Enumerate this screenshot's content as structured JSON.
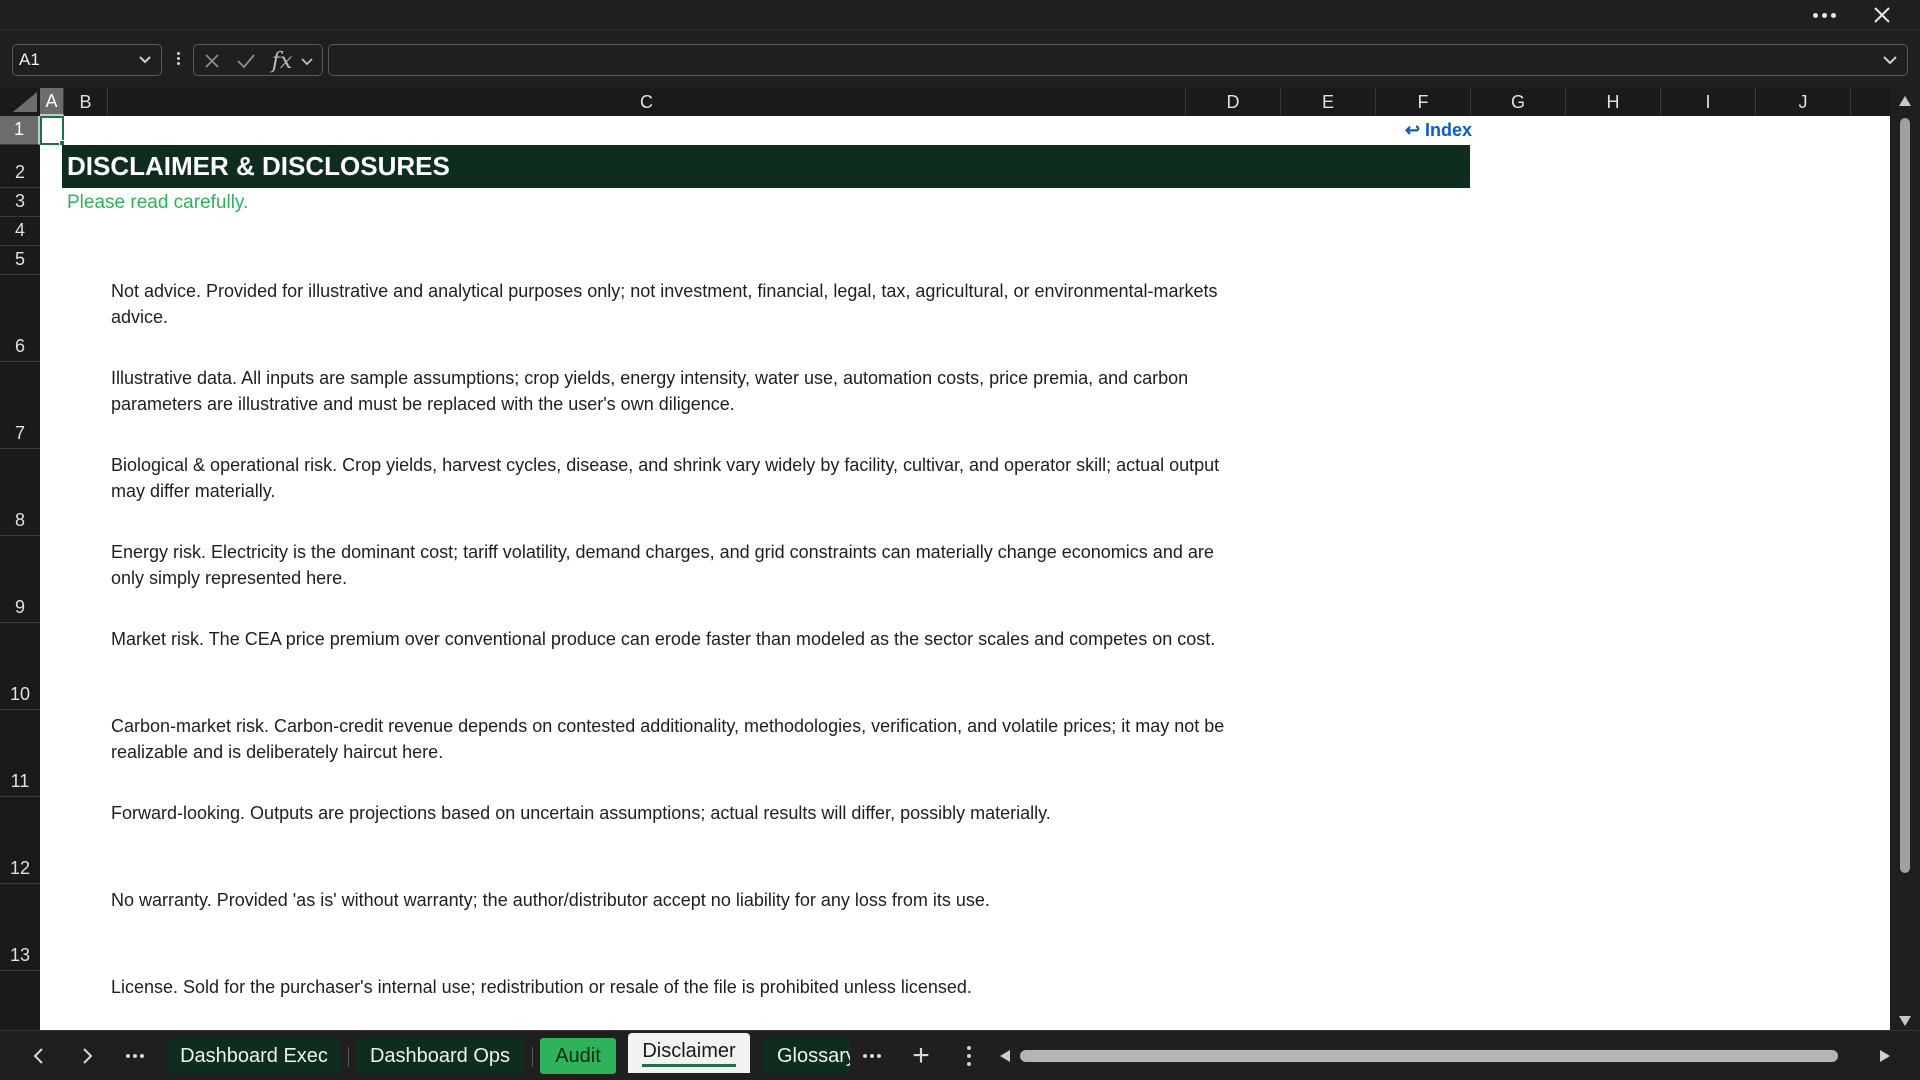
{
  "formula_bar": {
    "name_box": "A1",
    "formula": ""
  },
  "columns": [
    "A",
    "B",
    "C",
    "D",
    "E",
    "F",
    "G",
    "H",
    "I",
    "J"
  ],
  "rows": [
    "1",
    "2",
    "3",
    "4",
    "5",
    "6",
    "7",
    "8",
    "9",
    "10",
    "11",
    "12",
    "13"
  ],
  "sheet": {
    "index_link": "↩ Index",
    "banner": "DISCLAIMER & DISCLOSURES",
    "subtitle": "Please read carefully.",
    "paragraphs": [
      "Not advice. Provided for illustrative and analytical purposes only; not investment, financial, legal, tax, agricultural, or environmental-markets advice.",
      "Illustrative data. All inputs are sample assumptions; crop yields, energy intensity, water use, automation costs, price premia, and carbon parameters are illustrative and must be replaced with the user's own diligence.",
      "Biological & operational risk. Crop yields, harvest cycles, disease, and shrink vary widely by facility, cultivar, and operator skill; actual output may differ materially.",
      "Energy risk. Electricity is the dominant cost; tariff volatility, demand charges, and grid constraints can materially change economics and are only simply represented here.",
      "Market risk. The CEA price premium over conventional produce can erode faster than modeled as the sector scales and competes on cost.",
      "Carbon-market risk. Carbon-credit revenue depends on contested additionality, methodologies, verification, and volatile prices; it may not be realizable and is deliberately haircut here.",
      "Forward-looking. Outputs are projections based on uncertain assumptions; actual results will differ, possibly materially.",
      "No warranty. Provided 'as is' without warranty; the author/distributor accept no liability for any loss from its use.",
      "License. Sold for the purchaser's internal use; redistribution or resale of the file is prohibited unless licensed."
    ]
  },
  "tabs": {
    "items": [
      "Dashboard Exec",
      "Dashboard Ops",
      "Audit",
      "Disclaimer",
      "Glossary"
    ],
    "active": "Disclaimer",
    "add_symbol": "+"
  },
  "colors": {
    "banner_bg": "#0f2d1f",
    "subtitle": "#2fb35a",
    "link": "#0a5ec2",
    "audit_tab": "#2fb35a",
    "selection": "#1e7145"
  },
  "icons": [
    "more-icon",
    "close-icon",
    "chevron-down-icon",
    "cancel-icon",
    "enter-icon",
    "function-icon",
    "select-all-icon",
    "scroll-left-icon",
    "scroll-right-icon",
    "add-sheet-icon"
  ]
}
